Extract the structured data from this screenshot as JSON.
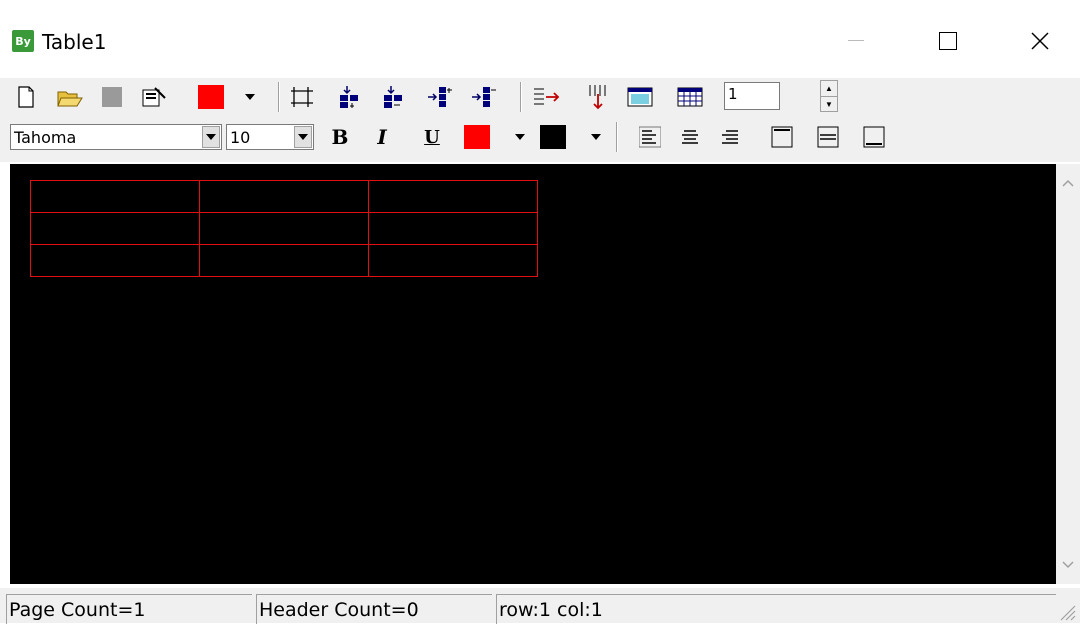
{
  "window": {
    "title": "Table1",
    "app_icon_text": "By"
  },
  "toolbar1": {
    "spin_value": "1",
    "color_swatch": "#ff0000"
  },
  "toolbar2": {
    "font_name": "Tahoma",
    "font_size": "10",
    "bold_label": "B",
    "italic_label": "I",
    "underline_label": "U",
    "font_color": "#ff0000",
    "back_color": "#000000"
  },
  "table": {
    "rows": 3,
    "cols": 3,
    "border_color": "#e01010",
    "background": "#000000"
  },
  "status": {
    "page_count": "Page Count=1",
    "header_count": "Header Count=0",
    "position": "row:1 col:1"
  }
}
